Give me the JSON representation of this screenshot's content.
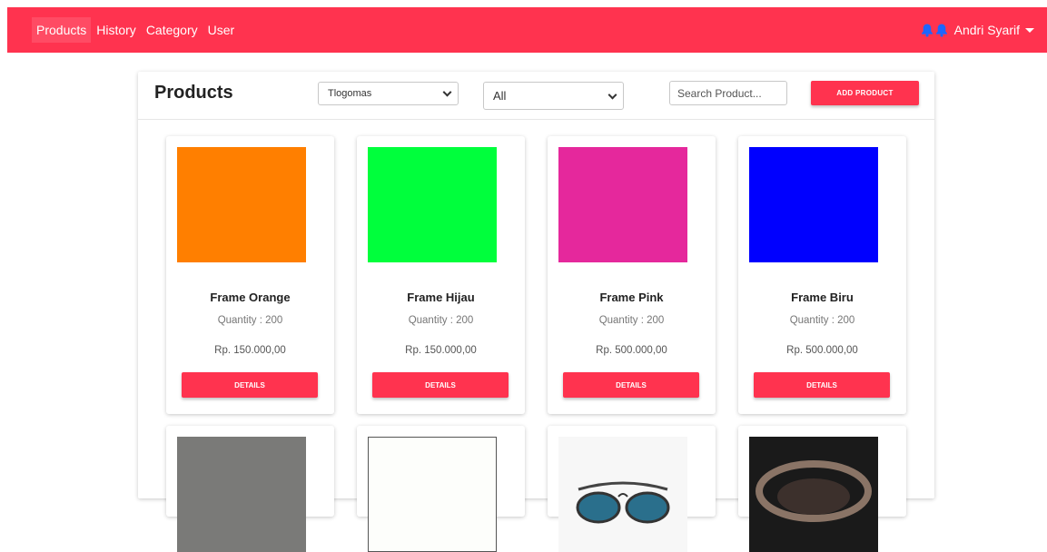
{
  "nav": {
    "items": [
      {
        "label": "Products",
        "active": true
      },
      {
        "label": "History",
        "active": false
      },
      {
        "label": "Category",
        "active": false
      },
      {
        "label": "User",
        "active": false
      }
    ],
    "user_name": "Andri Syarif",
    "bell_color": "#1e66ff",
    "brand_color": "#ff334f"
  },
  "panel": {
    "title": "Products",
    "location_select": "Tlogomas",
    "category_select": "All",
    "search_placeholder": "Search Product...",
    "add_button": "ADD PRODUCT"
  },
  "products": [
    {
      "name": "Frame Orange",
      "quantity": "Quantity : 200",
      "price": "Rp. 150.000,00",
      "color": "#ff7f00",
      "button": "DETAILS"
    },
    {
      "name": "Frame Hijau",
      "quantity": "Quantity : 200",
      "price": "Rp. 150.000,00",
      "color": "#00ff3c",
      "button": "DETAILS"
    },
    {
      "name": "Frame Pink",
      "quantity": "Quantity : 200",
      "price": "Rp. 500.000,00",
      "color": "#e5289c",
      "button": "DETAILS"
    },
    {
      "name": "Frame Biru",
      "quantity": "Quantity : 200",
      "price": "Rp. 500.000,00",
      "color": "#0000ff",
      "button": "DETAILS"
    }
  ],
  "products_row2": [
    {
      "image": "gray-swatch",
      "color": "#7a7a78"
    },
    {
      "image": "white-swatch",
      "color": "#fdfefb"
    },
    {
      "image": "sunglasses-photo",
      "color": "#ffffff"
    },
    {
      "image": "dark-glasses-photo",
      "color": "#1e1e1e"
    }
  ]
}
